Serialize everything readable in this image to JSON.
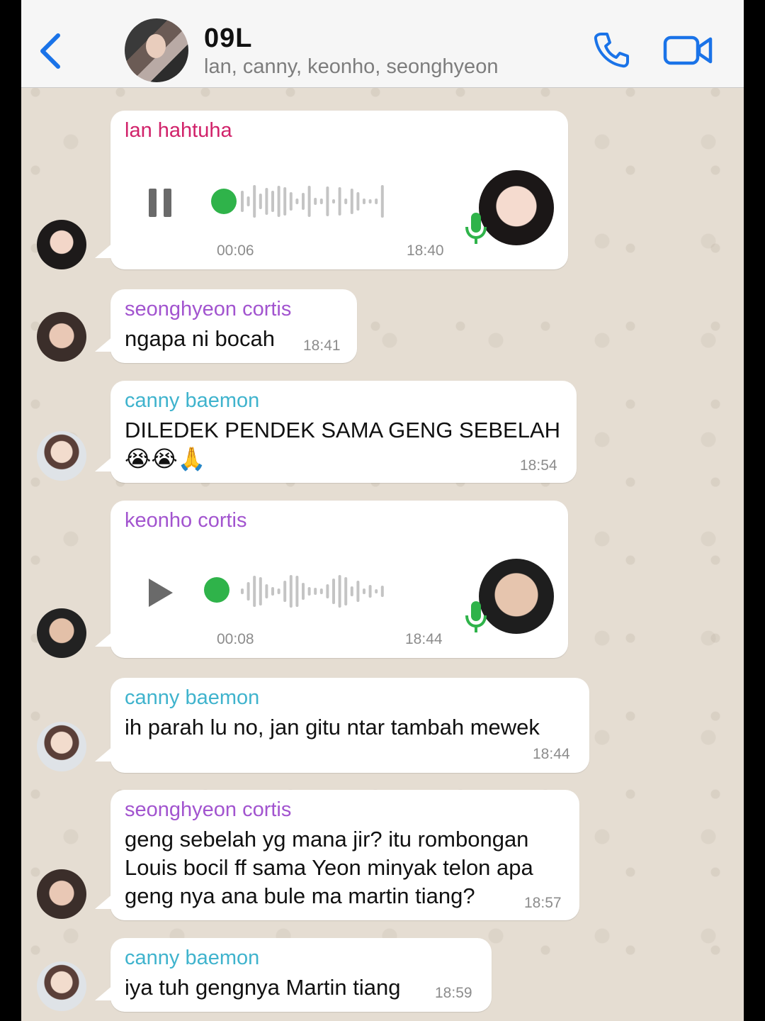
{
  "header": {
    "title": "09L",
    "members": "lan, canny, keonho, seonghyeon",
    "back_icon": "chevron-left-icon",
    "call_icon": "phone-icon",
    "video_icon": "video-camera-icon",
    "accent_color": "#1a73e8"
  },
  "messages": [
    {
      "sender": "lan hahtuha",
      "type": "voice",
      "duration": "00:06",
      "time": "18:40",
      "state": "playing"
    },
    {
      "sender": "seonghyeon cortis",
      "type": "text",
      "text": "ngapa ni bocah",
      "time": "18:41"
    },
    {
      "sender": "canny baemon",
      "type": "text",
      "text": "DILEDEK PENDEK SAMA GENG SEBELAH",
      "emoji": "😭😭🙏",
      "time": "18:54"
    },
    {
      "sender": "keonho cortis",
      "type": "voice",
      "duration": "00:08",
      "time": "18:44",
      "state": "paused"
    },
    {
      "sender": "canny baemon",
      "type": "text",
      "text": "ih parah lu no, jan gitu ntar tambah mewek",
      "time": "18:44"
    },
    {
      "sender": "seonghyeon cortis",
      "type": "text",
      "lines": [
        "geng sebelah yg mana jir? itu rombongan",
        "Louis bocil ff sama Yeon minyak telon apa",
        "geng nya ana bule ma martin tiang?"
      ],
      "time": "18:57"
    },
    {
      "sender": "canny baemon",
      "type": "text",
      "text": "iya tuh gengnya Martin tiang",
      "time": "18:59"
    }
  ]
}
